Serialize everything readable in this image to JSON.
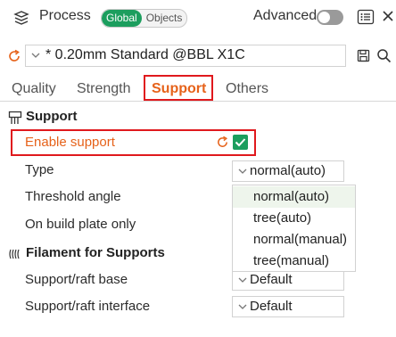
{
  "header": {
    "title": "Process",
    "mode_options": [
      "Global",
      "Objects"
    ],
    "advanced_label": "Advanced"
  },
  "preset": {
    "value": "* 0.20mm Standard @BBL X1C"
  },
  "tabs": [
    "Quality",
    "Strength",
    "Support",
    "Others"
  ],
  "active_tab": "Support",
  "support_section": {
    "title": "Support",
    "enable_label": "Enable support",
    "enable_checked": true,
    "type_label": "Type",
    "type_value": "normal(auto)",
    "threshold_label": "Threshold angle",
    "build_plate_label": "On build plate only"
  },
  "type_dropdown": {
    "options": [
      "normal(auto)",
      "tree(auto)",
      "normal(manual)",
      "tree(manual)"
    ],
    "highlighted": "normal(auto)"
  },
  "filament_section": {
    "title": "Filament for Supports",
    "base_label": "Support/raft base",
    "base_value": "Default",
    "interface_label": "Support/raft interface",
    "interface_value": "Default"
  },
  "colors": {
    "accent": "#1c9e5e",
    "highlight": "#e6621a",
    "annotation_border": "#e0191d"
  },
  "icons": [
    "layers-icon",
    "toggle",
    "list-icon",
    "close-icon",
    "reset-icon",
    "save-icon",
    "search-icon",
    "chevron-down-icon",
    "support-icon",
    "filament-icon",
    "checkbox"
  ]
}
